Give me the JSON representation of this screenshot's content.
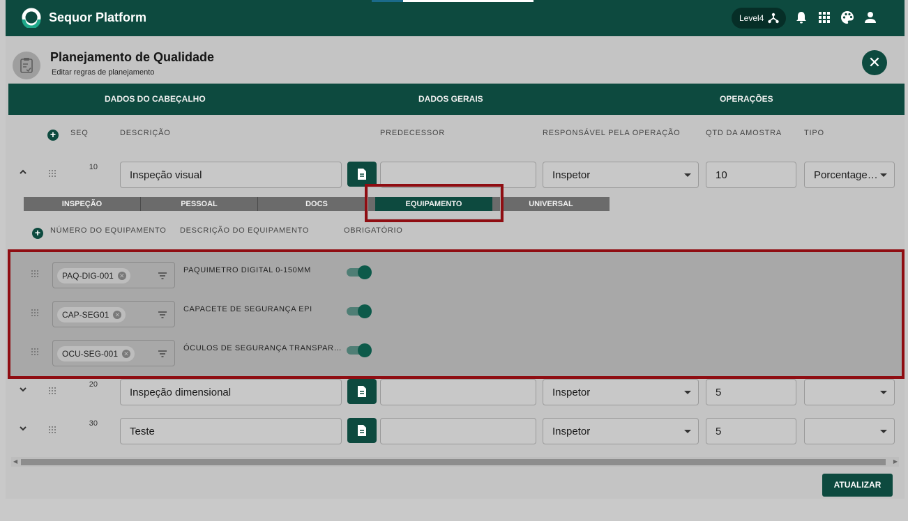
{
  "app": {
    "title": "Sequor Platform",
    "level": "Level4"
  },
  "topbar_icons": [
    "network-icon",
    "bell-icon",
    "apps-grid-icon",
    "palette-icon",
    "user-icon"
  ],
  "page": {
    "title": "Planejamento de Qualidade",
    "subtitle": "Editar regras de planejamento"
  },
  "main_tabs": [
    {
      "label": "DADOS DO CABEÇALHO"
    },
    {
      "label": "DADOS GERAIS"
    },
    {
      "label": "OPERAÇÕES",
      "active": true
    }
  ],
  "columns": {
    "seq": "SEQ",
    "descricao": "DESCRIÇÃO",
    "predecessor": "PREDECESSOR",
    "responsavel": "RESPONSÁVEL PELA OPERAÇÃO",
    "qtd": "QTD DA AMOSTRA",
    "tipo": "TIPO"
  },
  "operations": [
    {
      "seq": "10",
      "descricao": "Inspeção visual",
      "predecessor": "",
      "responsavel": "Inspetor",
      "qtd": "10",
      "tipo": "Porcentage…",
      "expanded": true
    },
    {
      "seq": "20",
      "descricao": "Inspeção dimensional",
      "predecessor": "",
      "responsavel": "Inspetor",
      "qtd": "5",
      "tipo": "",
      "expanded": false
    },
    {
      "seq": "30",
      "descricao": "Teste",
      "predecessor": "",
      "responsavel": "Inspetor",
      "qtd": "5",
      "tipo": "",
      "expanded": false
    }
  ],
  "sub_tabs": [
    {
      "label": "INSPEÇÃO"
    },
    {
      "label": "PESSOAL"
    },
    {
      "label": "DOCS"
    },
    {
      "label": "EQUIPAMENTO",
      "active": true
    },
    {
      "label": "UNIVERSAL"
    }
  ],
  "equipment_columns": {
    "numero": "NÚMERO DO EQUIPAMENTO",
    "descricao": "DESCRIÇÃO DO EQUIPAMENTO",
    "obrigatorio": "OBRIGATÓRIO"
  },
  "equipment": [
    {
      "numero": "PAQ-DIG-001",
      "descricao": "PAQUIMETRO DIGITAL 0-150MM",
      "obrigatorio": true
    },
    {
      "numero": "CAP-SEG01",
      "descricao": "CAPACETE DE SEGURANÇA EPI",
      "obrigatorio": true
    },
    {
      "numero": "OCU-SEG-001",
      "descricao": "ÓCULOS DE SEGURANÇA TRANSPAR…",
      "obrigatorio": true
    }
  ],
  "actions": {
    "update": "ATUALIZAR"
  },
  "colors": {
    "primary": "#0d4a3f",
    "highlight": "#8f0d12",
    "toggle_on": "#0d5a4a"
  }
}
